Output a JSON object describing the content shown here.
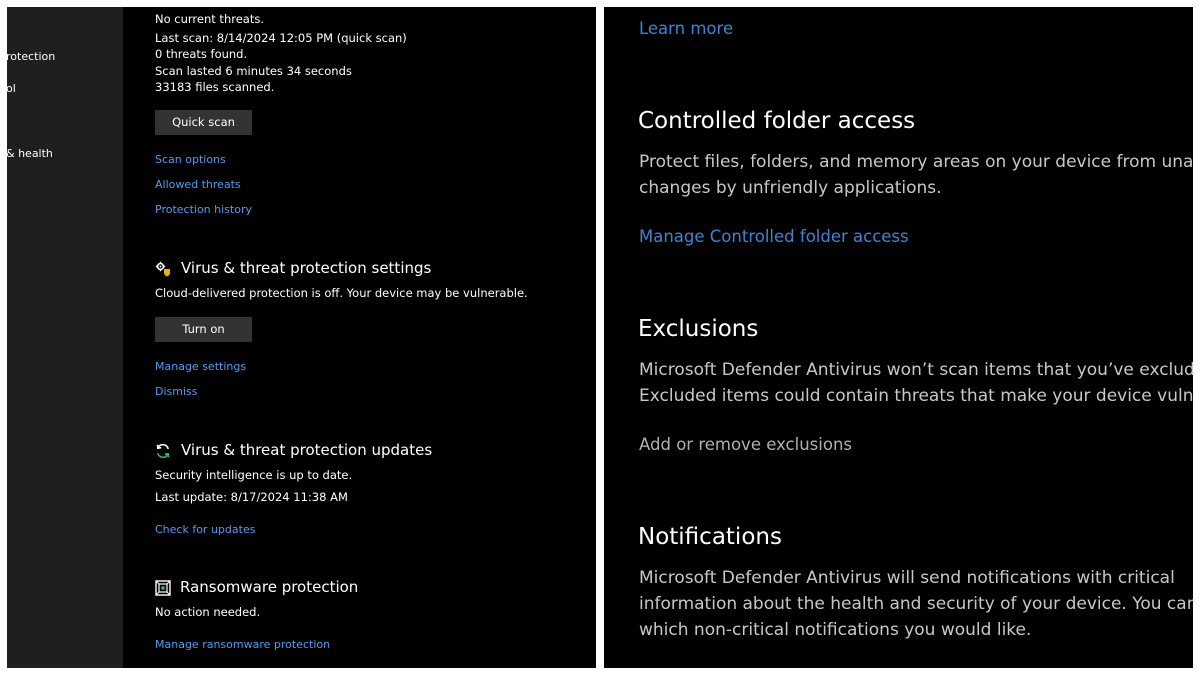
{
  "sidebar": {
    "items": [
      {
        "label": "rotection"
      },
      {
        "label": "ol"
      },
      {
        "label": "& health"
      }
    ]
  },
  "scan": {
    "status": "No current threats.",
    "last_scan": "Last scan: 8/14/2024 12:05 PM (quick scan)",
    "threats_found": "0 threats found.",
    "duration": "Scan lasted 6 minutes 34 seconds",
    "files": "33183 files scanned.",
    "quick_scan_label": "Quick scan",
    "links": [
      "Scan options",
      "Allowed threats",
      "Protection history"
    ]
  },
  "settings": {
    "title": "Virus & threat protection settings",
    "description": "Cloud-delivered protection is off. Your device may be vulnerable.",
    "turn_on_label": "Turn on",
    "manage_link": "Manage settings",
    "dismiss_link": "Dismiss"
  },
  "updates": {
    "title": "Virus & threat protection updates",
    "status": "Security intelligence is up to date.",
    "last_update": "Last update: 8/17/2024 11:38 AM",
    "check_link": "Check for updates"
  },
  "ransomware": {
    "title": "Ransomware protection",
    "status": "No action needed.",
    "manage_link": "Manage ransomware protection"
  },
  "zoomed": {
    "learn_more": "Learn more",
    "cfa": {
      "title": "Controlled folder access",
      "line1": "Protect files, folders, and memory areas on your device from unau",
      "line2": "changes by unfriendly applications.",
      "link": "Manage Controlled folder access"
    },
    "exclusions": {
      "title": "Exclusions",
      "line1": "Microsoft Defender Antivirus won’t scan items that you’ve exclude",
      "line2": "Excluded items could contain threats that make your device vulne",
      "link": "Add or remove exclusions"
    },
    "notifications": {
      "title": "Notifications",
      "line1": "Microsoft Defender Antivirus will send notifications with critical",
      "line2": "information about the health and security of your device. You can",
      "line3": "which non-critical notifications you would like."
    }
  },
  "colors": {
    "background": "#000000",
    "sidebar": "#1f1f1f",
    "link": "#4c9ff5",
    "button": "#333333",
    "text": "#ffffff",
    "divider": "#ffffff"
  },
  "icons": {
    "settings": "gear-shield-icon",
    "updates": "refresh-icon",
    "ransomware": "ransomware-icon"
  }
}
